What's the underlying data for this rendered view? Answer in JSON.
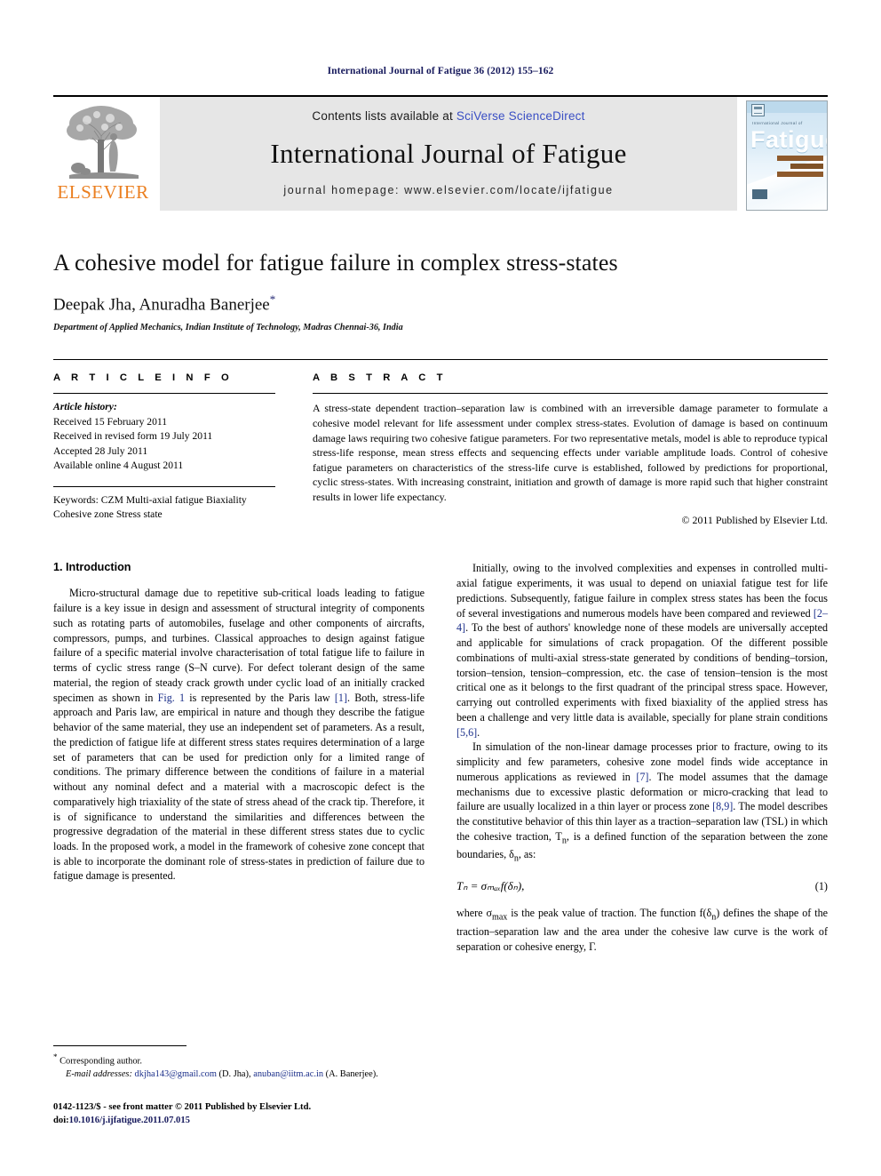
{
  "running_head": "International Journal of Fatigue 36 (2012) 155–162",
  "masthead": {
    "elsevier_wordmark": "ELSEVIER",
    "contents_prefix": "Contents lists available at ",
    "sciencedirect_link": "SciVerse ScienceDirect",
    "journal_title": "International Journal of Fatigue",
    "homepage_line": "journal homepage: www.elsevier.com/locate/ijfatigue",
    "cover": {
      "small_label": "International Journal of",
      "big_title": "Fatigue"
    }
  },
  "article": {
    "title": "A cohesive model for fatigue failure in complex stress-states",
    "authors": "Deepak Jha, Anuradha Banerjee",
    "corresponding_marker": "*",
    "affiliation": "Department of Applied Mechanics, Indian Institute of Technology, Madras Chennai-36, India"
  },
  "article_info": {
    "heading": "A R T I C L E    I N F O",
    "history_label": "Article history:",
    "history": [
      "Received 15 February 2011",
      "Received in revised form 19 July 2011",
      "Accepted 28 July 2011",
      "Available online 4 August 2011"
    ],
    "keywords_label": "Keywords:",
    "keywords": [
      "CZM",
      "Multi-axial fatigue",
      "Biaxiality",
      "Cohesive zone",
      "Stress state"
    ]
  },
  "abstract": {
    "heading": "A B S T R A C T",
    "text": "A stress-state dependent traction–separation law is combined with an irreversible damage parameter to formulate a cohesive model relevant for life assessment under complex stress-states. Evolution of damage is based on continuum damage laws requiring two cohesive fatigue parameters. For two representative metals, model is able to reproduce typical stress-life response, mean stress effects and sequencing effects under variable amplitude loads. Control of cohesive fatigue parameters on characteristics of the stress-life curve is established, followed by predictions for proportional, cyclic stress-states. With increasing constraint, initiation and growth of damage is more rapid such that higher constraint results in lower life expectancy.",
    "copyright": "© 2011 Published by Elsevier Ltd."
  },
  "body": {
    "section_heading": "1. Introduction",
    "left_para_1_a": "Micro-structural damage due to repetitive sub-critical loads leading to fatigue failure is a key issue in design and assessment of structural integrity of components such as rotating parts of automobiles, fuselage and other components of aircrafts, compressors, pumps, and turbines. Classical approaches to design against fatigue failure of a specific material involve characterisation of total fatigue life to failure in terms of cyclic stress range (S–N curve). For defect tolerant design of the same material, the region of steady crack growth under cyclic load of an initially cracked specimen as shown in ",
    "left_fig_ref": "Fig. 1",
    "left_para_1_b": " is represented by the Paris law ",
    "left_ref_1": "[1]",
    "left_para_1_c": ". Both, stress-life approach and Paris law, are empirical in nature and though they describe the fatigue behavior of the same material, they use an independent set of parameters. As a result, the prediction of fatigue life at different stress states requires determination of a large set of parameters that can be used for prediction only for a limited range of conditions. The primary difference between the conditions of failure in a material without any nominal defect and a material with a macroscopic defect is the comparatively high triaxiality of the state of stress ahead of the crack tip. Therefore, it is of significance to understand the similarities and differences between the progressive degradation of the material in these different stress states due to cyclic loads. In the proposed work, a model in the framework of cohesive zone concept that is able to incorporate the dominant role of stress-states in prediction of failure due to fatigue damage is presented.",
    "right_para_1_a": "Initially, owing to the involved complexities and expenses in controlled multi-axial fatigue experiments, it was usual to depend on uniaxial fatigue test for life predictions. Subsequently, fatigue failure in complex stress states has been the focus of several investigations and numerous models have been compared and reviewed ",
    "right_ref_2_4": "[2–4]",
    "right_para_1_b": ". To the best of authors' knowledge none of these models are universally accepted and applicable for simulations of crack propagation. Of the different possible combinations of multi-axial stress-state generated by conditions of bending–torsion, torsion–tension, tension–compression, etc. the case of tension–tension is the most critical one as it belongs to the first quadrant of the principal stress space. However, carrying out controlled experiments with fixed biaxiality of the applied stress has been a challenge and very little data is available, specially for plane strain conditions ",
    "right_ref_5_6": "[5,6]",
    "right_para_1_c": ".",
    "right_para_2_a": "In simulation of the non-linear damage processes prior to fracture, owing to its simplicity and few parameters, cohesive zone model finds wide acceptance in numerous applications as reviewed in ",
    "right_ref_7": "[7]",
    "right_para_2_b": ". The model assumes that the damage mechanisms due to excessive plastic deformation or micro-cracking that lead to failure are usually localized in a thin layer or process zone ",
    "right_ref_8_9": "[8,9]",
    "right_para_2_c": ". The model describes the constitutive behavior of this thin layer as a traction–separation law (TSL) in which the cohesive traction, T",
    "right_para_2_sub_n": "n",
    "right_para_2_d": ", is a defined function of the separation between the zone boundaries, δ",
    "right_para_2_sub_n2": "n",
    "right_para_2_e": ", as:",
    "equation_1": "Tₙ = σₘₐₓf(δₙ),",
    "equation_1_number": "(1)",
    "right_para_3_a": "where σ",
    "right_para_3_sub": "max",
    "right_para_3_b": " is the peak value of traction. The function f(δ",
    "right_para_3_sub2": "n",
    "right_para_3_c": ") defines the shape of the traction–separation law and the area under the cohesive law curve is the work of separation or cohesive energy, Γ."
  },
  "footnotes": {
    "corresponding_marker": "*",
    "corresponding_text": " Corresponding author.",
    "email_label": "E-mail addresses:",
    "email_1": "dkjha143@gmail.com",
    "email_1_owner": " (D. Jha), ",
    "email_2": "anuban@iitm.ac.in",
    "email_2_owner": " (A. Banerjee)."
  },
  "imprint": {
    "front_matter": "0142-1123/$ - see front matter © 2011 Published by Elsevier Ltd.",
    "doi_prefix": "doi:",
    "doi": "10.1016/j.ijfatigue.2011.07.015"
  },
  "colors": {
    "link_blue": "#1b2f8a",
    "sciencedirect_blue": "#3a4fc4",
    "elsevier_orange": "#eb7f20",
    "running_head_navy": "#16195c",
    "band_gray": "#e6e6e6"
  }
}
